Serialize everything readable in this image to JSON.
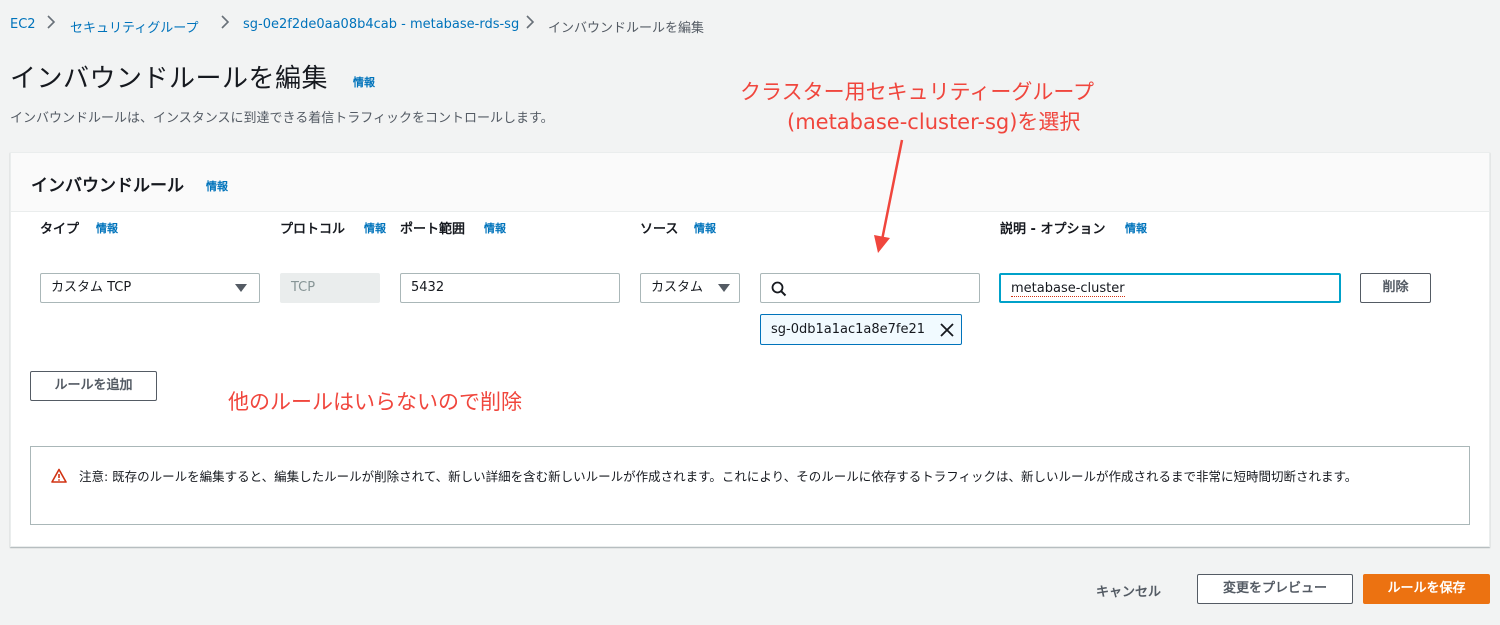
{
  "breadcrumb": {
    "items": [
      "EC2",
      "セキュリティグループ",
      "sg-0e2f2de0aa08b4cab - metabase-rds-sg"
    ],
    "current": "インバウンドルールを編集"
  },
  "page": {
    "title": "インバウンドルールを編集",
    "info_link": "情報",
    "description": "インバウンドルールは、インスタンスに到達できる着信トラフィックをコントロールします。"
  },
  "panel": {
    "title": "インバウンドルール",
    "info_link": "情報"
  },
  "columns": {
    "type": "タイプ",
    "protocol": "プロトコル",
    "port_range": "ポート範囲",
    "source": "ソース",
    "description": "説明 - オプション",
    "info": "情報"
  },
  "rule": {
    "type_value": "カスタム TCP",
    "protocol_value": "TCP",
    "port_value": "5432",
    "source_type": "カスタム",
    "source_search_value": "",
    "source_token": "sg-0db1a1ac1a8e7fe21",
    "description_value": "metabase-cluster",
    "delete_label": "削除"
  },
  "add_rule_label": "ルールを追加",
  "warning": {
    "text": "注意: 既存のルールを編集すると、編集したルールが削除されて、新しい詳細を含む新しいルールが作成されます。これにより、そのルールに依存するトラフィックは、新しいルールが作成されるまで非常に短時間切断されます。"
  },
  "footer": {
    "cancel": "キャンセル",
    "preview": "変更をプレビュー",
    "save": "ルールを保存"
  },
  "annotations": {
    "select_sg_line1": "クラスター用セキュリティーグループ",
    "select_sg_line2": "(metabase-cluster-sg)を選択",
    "delete_others": "他のルールはいらないので削除"
  },
  "colors": {
    "link": "#0073bb",
    "primary": "#ec7211",
    "annotation": "#f0463d",
    "warning_icon": "#d13212"
  },
  "icons": {
    "breadcrumb_separator": "chevron-right-icon",
    "dropdown": "caret-down-icon",
    "search": "search-icon",
    "remove_token": "close-icon",
    "warning": "warning-icon"
  }
}
